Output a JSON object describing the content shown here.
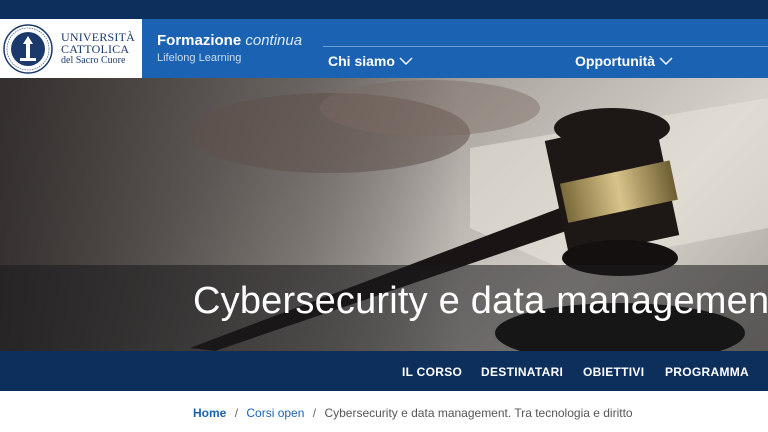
{
  "logo": {
    "line1": "UNIVERSITÀ",
    "line2": "CATTOLICA",
    "line3": "del Sacro Cuore",
    "seal_icon": "university-seal-icon"
  },
  "brand": {
    "title_bold": "Formazione",
    "title_italic": "continua",
    "subtitle": "Lifelong Learning"
  },
  "nav": {
    "items": [
      {
        "label": "Chi siamo",
        "icon": "chevron-down-icon"
      },
      {
        "label": "Opportunità",
        "icon": "chevron-down-icon"
      }
    ]
  },
  "hero": {
    "title": "Cybersecurity e data management."
  },
  "subnav": {
    "items": [
      "IL CORSO",
      "DESTINATARI",
      "OBIETTIVI",
      "PROGRAMMA"
    ]
  },
  "breadcrumb": {
    "home": "Home",
    "separator": "/",
    "level1": "Corsi open",
    "current": "Cybersecurity e data management. Tra tecnologia e diritto"
  },
  "colors": {
    "top_strip": "#0c2f5c",
    "header_blue": "#1b63b2",
    "subnav_navy": "#0c2f5c",
    "link_blue": "#1b63b2"
  }
}
